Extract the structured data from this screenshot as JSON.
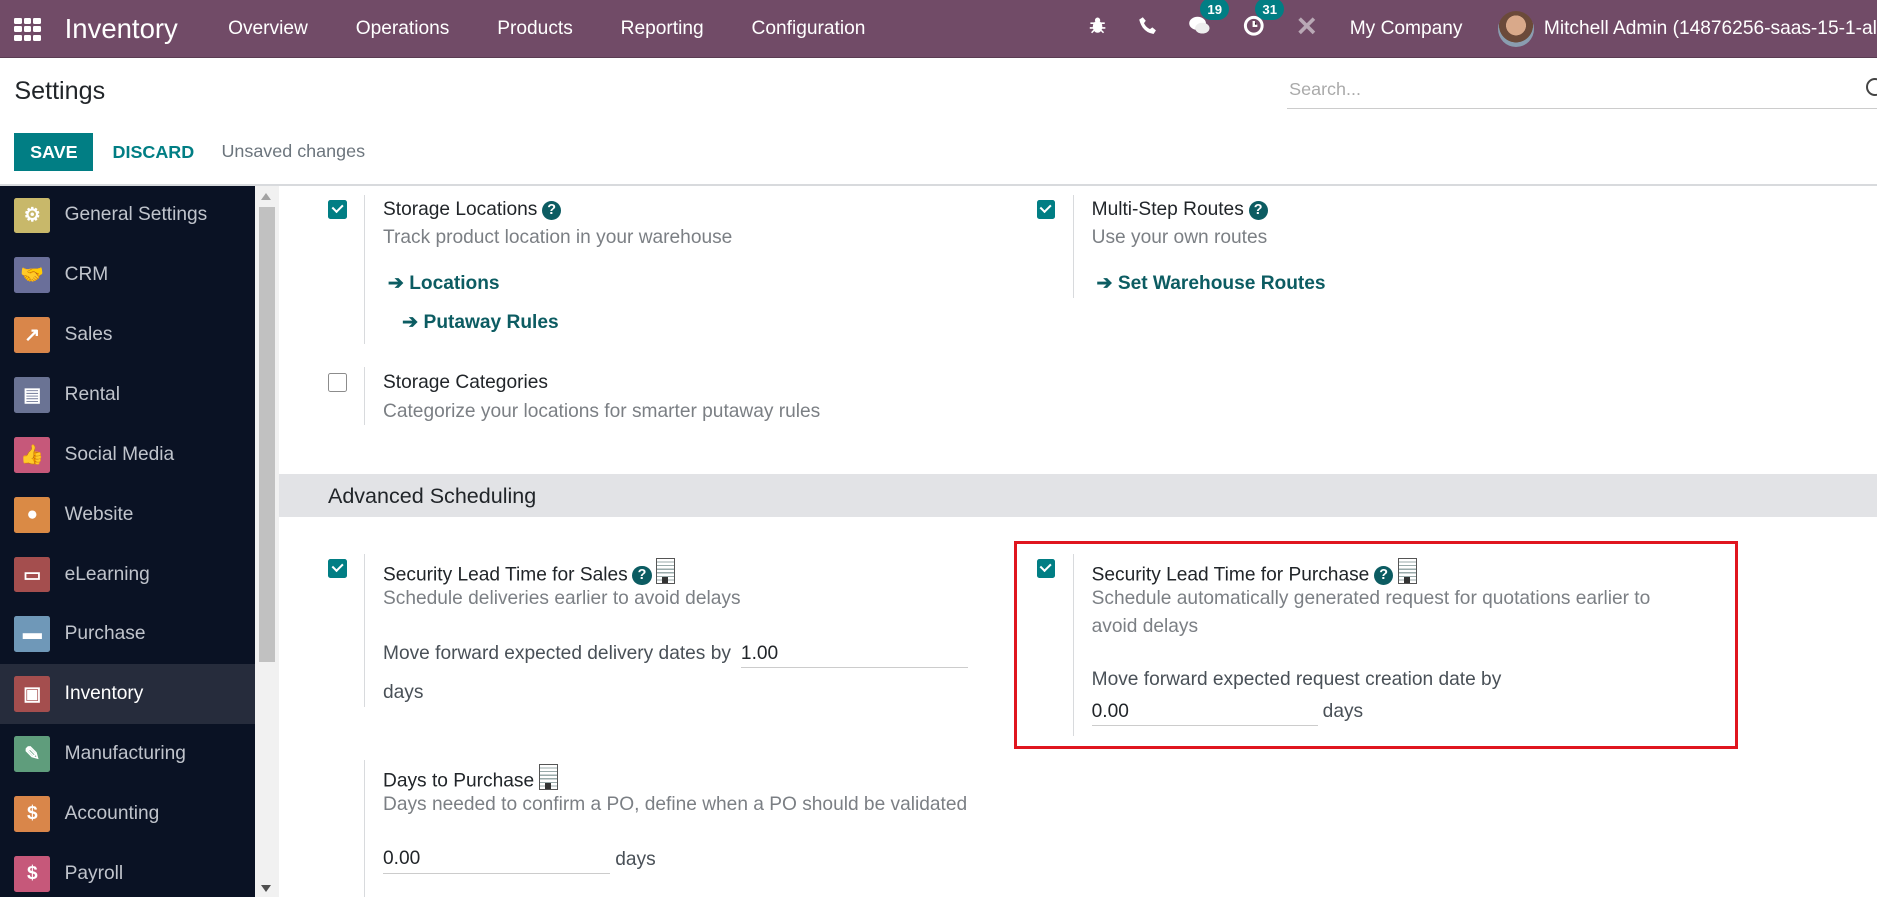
{
  "navbar": {
    "app_title": "Inventory",
    "menu": [
      "Overview",
      "Operations",
      "Products",
      "Reporting",
      "Configuration"
    ],
    "messages_count": "19",
    "activities_count": "31",
    "company": "My Company",
    "user": "Mitchell Admin (14876256-saas-15-1-al"
  },
  "control_panel": {
    "title": "Settings",
    "search_placeholder": "Search...",
    "save_label": "SAVE",
    "discard_label": "DISCARD",
    "status": "Unsaved changes"
  },
  "sidebar": {
    "items": [
      {
        "label": "General Settings",
        "icon": "gear-icon",
        "color": "#c8b86a"
      },
      {
        "label": "CRM",
        "icon": "handshake-icon",
        "color": "#6a6f9a"
      },
      {
        "label": "Sales",
        "icon": "chart-up-icon",
        "color": "#d9864a"
      },
      {
        "label": "Rental",
        "icon": "table-icon",
        "color": "#6a7394"
      },
      {
        "label": "Social Media",
        "icon": "thumbs-up-icon",
        "color": "#c6587a"
      },
      {
        "label": "Website",
        "icon": "globe-icon",
        "color": "#da8a45"
      },
      {
        "label": "eLearning",
        "icon": "presentation-icon",
        "color": "#a44e4e"
      },
      {
        "label": "Purchase",
        "icon": "credit-card-icon",
        "color": "#6f98b8"
      },
      {
        "label": "Inventory",
        "icon": "box-icon",
        "color": "#a44e4e",
        "active": true
      },
      {
        "label": "Manufacturing",
        "icon": "wrench-icon",
        "color": "#5f9d7c"
      },
      {
        "label": "Accounting",
        "icon": "invoice-icon",
        "color": "#d9864a"
      },
      {
        "label": "Payroll",
        "icon": "payroll-icon",
        "color": "#c6587a"
      }
    ]
  },
  "settings": {
    "storage_locations": {
      "title": "Storage Locations",
      "desc": "Track product location in your warehouse",
      "checked": true,
      "links": [
        "Locations",
        "Putaway Rules"
      ]
    },
    "multi_step_routes": {
      "title": "Multi-Step Routes",
      "desc": "Use your own routes",
      "checked": true,
      "links": [
        "Set Warehouse Routes"
      ]
    },
    "storage_categories": {
      "title": "Storage Categories",
      "desc": "Categorize your locations for smarter putaway rules",
      "checked": false
    },
    "section_title": "Advanced Scheduling",
    "lead_time_sales": {
      "title": "Security Lead Time for Sales",
      "desc": "Schedule deliveries earlier to avoid delays",
      "checked": true,
      "field_label": "Move forward expected delivery dates by",
      "value": "1.00",
      "unit": "days"
    },
    "lead_time_purchase": {
      "title": "Security Lead Time for Purchase",
      "desc_line1": "Schedule automatically generated request for quotations earlier to",
      "desc_line2": "avoid delays",
      "checked": true,
      "field_label": "Move forward expected request creation date by",
      "value": "0.00",
      "unit": "days"
    },
    "days_to_purchase": {
      "title": "Days to Purchase",
      "desc": "Days needed to confirm a PO, define when a PO should be validated",
      "value": "0.00",
      "unit": "days"
    }
  },
  "help_glyph": "?",
  "arrow_glyph": "➔"
}
